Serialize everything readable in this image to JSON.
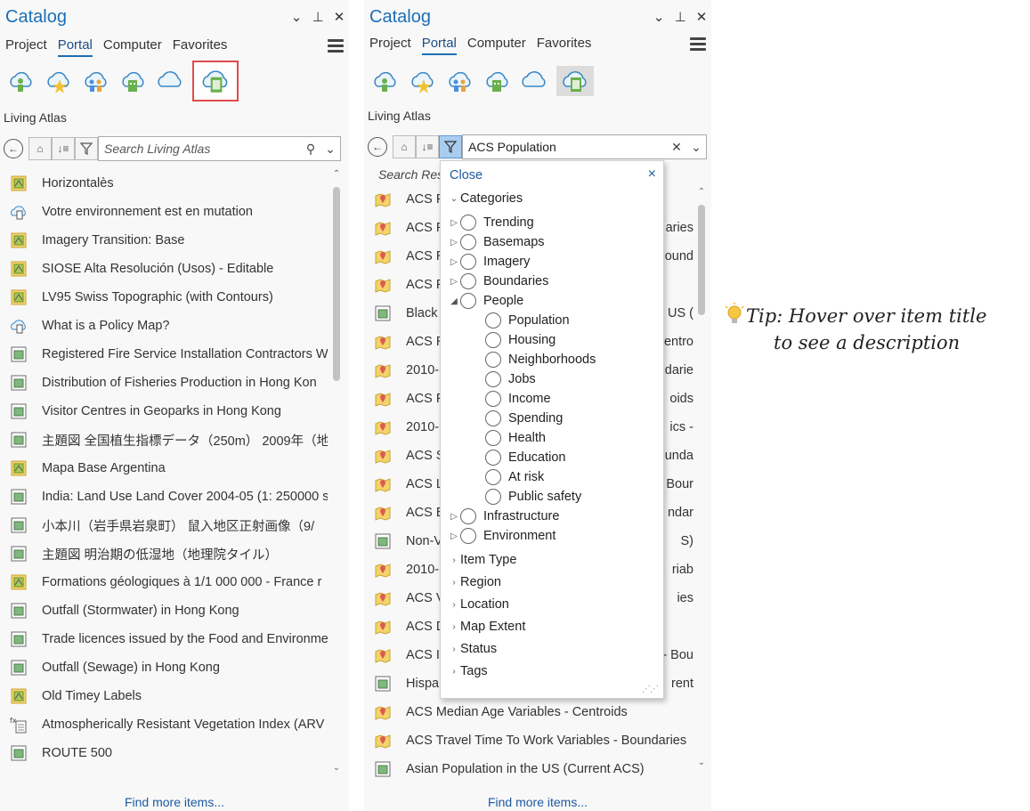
{
  "colors": {
    "accent": "#1c6fb5",
    "highlight_border": "#e04b4b",
    "filter_active": "#a9cdf0",
    "link": "#1c5aa0"
  },
  "panel_left": {
    "title": "Catalog",
    "tabs": [
      "Project",
      "Portal",
      "Computer",
      "Favorites"
    ],
    "active_tab": "Portal",
    "section": "Living Atlas",
    "search": {
      "placeholder": "Search Living Atlas",
      "value": ""
    },
    "items": [
      {
        "icon": "map-icon",
        "label": "Horizontalès"
      },
      {
        "icon": "globe-doc-icon",
        "label": "Votre environnement est en mutation"
      },
      {
        "icon": "map-icon",
        "label": "Imagery Transition: Base"
      },
      {
        "icon": "map-icon",
        "label": "SIOSE Alta Resolución (Usos) - Editable"
      },
      {
        "icon": "map-icon",
        "label": "LV95 Swiss Topographic (with Contours)"
      },
      {
        "icon": "globe-doc-icon",
        "label": "What is a Policy Map?"
      },
      {
        "icon": "layer-icon",
        "label": "Registered Fire Service Installation Contractors W"
      },
      {
        "icon": "layer-icon",
        "label": "Distribution of Fisheries Production in Hong Kon"
      },
      {
        "icon": "layer-icon",
        "label": "Visitor Centres in Geoparks in Hong Kong"
      },
      {
        "icon": "layer-icon",
        "label": "主題図 全国植生指標データ（250m） 2009年（地"
      },
      {
        "icon": "map-icon",
        "label": "Mapa Base Argentina"
      },
      {
        "icon": "layer-icon",
        "label": "India: Land Use Land Cover 2004-05 (1: 250000 s"
      },
      {
        "icon": "layer-icon",
        "label": "小本川（岩手県岩泉町） 鼠入地区正射画像（9/"
      },
      {
        "icon": "layer-icon",
        "label": "主題図 明治期の低湿地（地理院タイル）"
      },
      {
        "icon": "map-icon",
        "label": "Formations géologiques à 1/1 000 000 - France r"
      },
      {
        "icon": "layer-icon",
        "label": "Outfall (Stormwater) in Hong Kong"
      },
      {
        "icon": "layer-icon",
        "label": "Trade licences issued by the Food and Environme"
      },
      {
        "icon": "layer-icon",
        "label": "Outfall (Sewage) in Hong Kong"
      },
      {
        "icon": "map-icon",
        "label": "Old Timey Labels"
      },
      {
        "icon": "function-icon",
        "label": "Atmospherically Resistant Vegetation Index (ARV"
      },
      {
        "icon": "layer-icon",
        "label": "ROUTE 500"
      }
    ],
    "find_more": "Find more items..."
  },
  "panel_right": {
    "title": "Catalog",
    "tabs": [
      "Project",
      "Portal",
      "Computer",
      "Favorites"
    ],
    "active_tab": "Portal",
    "section": "Living Atlas",
    "search": {
      "placeholder": "",
      "value": "ACS Population"
    },
    "results_label": "Search Res",
    "items": [
      {
        "icon": "pin-map-icon",
        "left": "ACS P",
        "right": ""
      },
      {
        "icon": "pin-map-icon",
        "left": "ACS P",
        "right": "aries"
      },
      {
        "icon": "pin-map-icon",
        "left": "ACS R",
        "right": "ound"
      },
      {
        "icon": "pin-map-icon",
        "left": "ACS P",
        "right": ""
      },
      {
        "icon": "layer-icon",
        "left": "Black",
        "right": "US ("
      },
      {
        "icon": "pin-map-icon",
        "left": "ACS R",
        "right": "entro"
      },
      {
        "icon": "pin-map-icon",
        "left": "2010-",
        "right": "darie"
      },
      {
        "icon": "pin-map-icon",
        "left": "ACS P",
        "right": "oids"
      },
      {
        "icon": "pin-map-icon",
        "left": "2010-",
        "right": "ics -"
      },
      {
        "icon": "pin-map-icon",
        "left": "ACS S",
        "right": "unda"
      },
      {
        "icon": "pin-map-icon",
        "left": "ACS L",
        "right": "Bour"
      },
      {
        "icon": "pin-map-icon",
        "left": "ACS E",
        "right": "ndar"
      },
      {
        "icon": "layer-icon",
        "left": "Non-V",
        "right": "S)"
      },
      {
        "icon": "pin-map-icon",
        "left": "2010-",
        "right": "riab"
      },
      {
        "icon": "pin-map-icon",
        "left": "ACS V",
        "right": "ies"
      },
      {
        "icon": "pin-map-icon",
        "left": "ACS D",
        "right": ""
      },
      {
        "icon": "pin-map-icon",
        "left": "ACS Ir",
        "right": "- Bou"
      },
      {
        "icon": "layer-icon",
        "left": "Hispa",
        "right": "rent"
      },
      {
        "icon": "pin-map-icon",
        "left": "ACS Median Age Variables - Centroids",
        "right": ""
      },
      {
        "icon": "pin-map-icon",
        "left": "ACS Travel Time To Work Variables - Boundaries",
        "right": ""
      },
      {
        "icon": "layer-icon",
        "left": "Asian Population in the US (Current ACS)",
        "right": ""
      }
    ],
    "find_more": "Find more items..."
  },
  "filter_dropdown": {
    "close_label": "Close",
    "categories_label": "Categories",
    "categories": [
      "Trending",
      "Basemaps",
      "Imagery",
      "Boundaries",
      "People"
    ],
    "people_children": [
      "Population",
      "Housing",
      "Neighborhoods",
      "Jobs",
      "Income",
      "Spending",
      "Health",
      "Education",
      "At risk",
      "Public safety"
    ],
    "more_categories": [
      "Infrastructure",
      "Environment"
    ],
    "sections": [
      "Item Type",
      "Region",
      "Location",
      "Map Extent",
      "Status",
      "Tags"
    ]
  },
  "tip": {
    "line1": "Tip: Hover over item title",
    "line2": "to see a description"
  }
}
